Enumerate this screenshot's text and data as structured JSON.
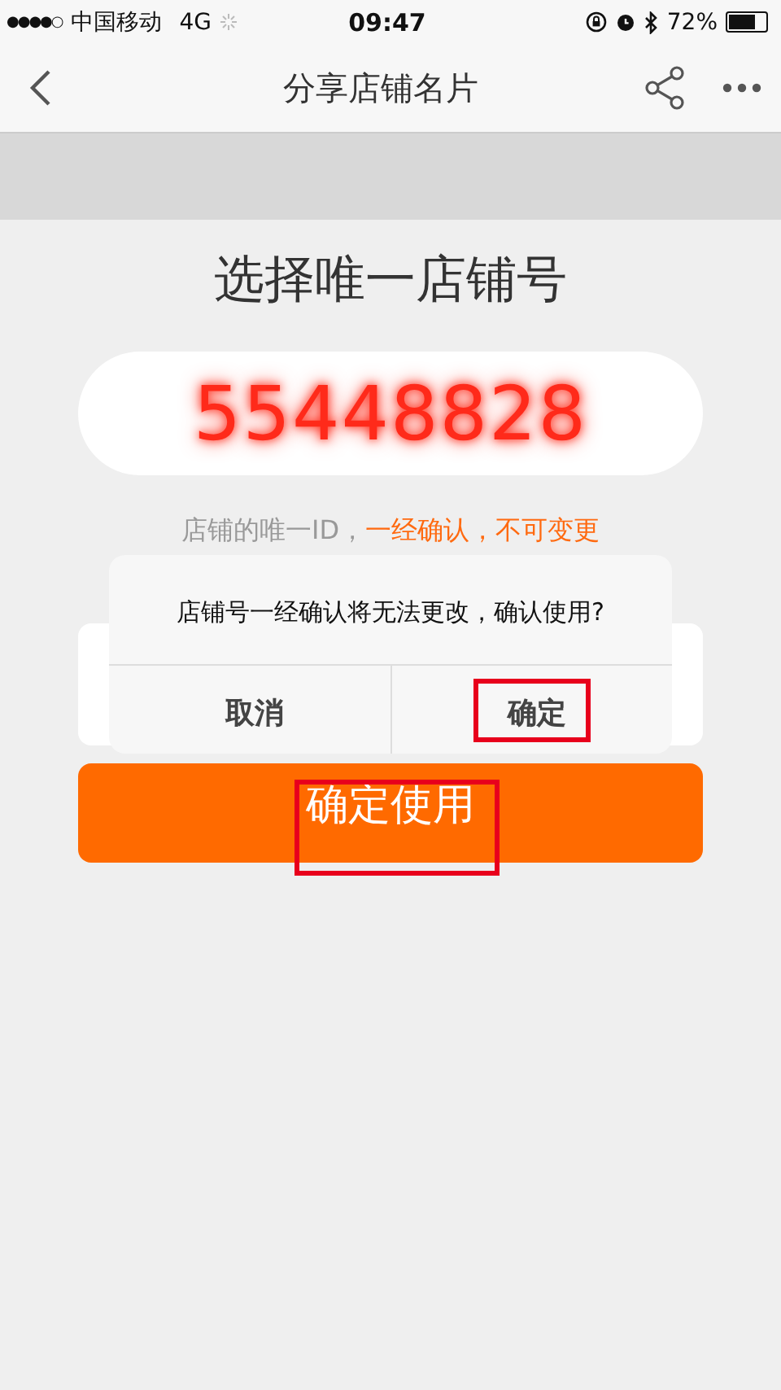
{
  "status_bar": {
    "signal_dots": "●●●●○",
    "carrier": "中国移动",
    "network": "4G",
    "time": "09:47",
    "battery": "72%"
  },
  "nav": {
    "title": "分享店铺名片"
  },
  "heading": "选择唯一店铺号",
  "shop_number": "55448828",
  "hint": {
    "text": "店铺的唯一ID，",
    "warning": "一经确认，不可变更"
  },
  "confirm_button": {
    "label": "确定使用",
    "highlighted": true
  },
  "dialog": {
    "message": "店铺号一经确认将无法更改，确认使用?",
    "buttons": [
      {
        "label": "取消",
        "highlighted": false
      },
      {
        "label": "确定",
        "highlighted": true
      }
    ]
  }
}
